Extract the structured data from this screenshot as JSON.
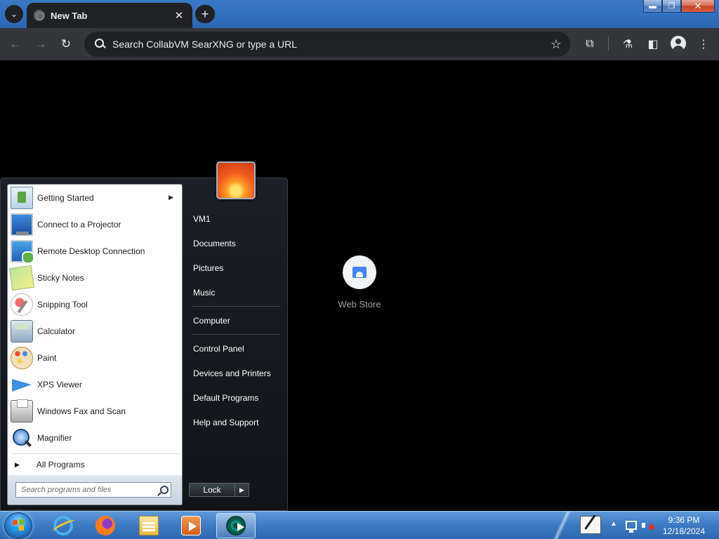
{
  "browser": {
    "tab": {
      "title": "New Tab",
      "close_glyph": "✕"
    },
    "new_tab_glyph": "+",
    "tab_list_glyph": "⌄",
    "window_controls": {
      "minimize": "▬",
      "restore": "❐",
      "close": "✕"
    },
    "nav": {
      "back": "←",
      "forward": "→",
      "reload": "↻"
    },
    "omnibox": {
      "placeholder": "Search CollabVM SearXNG or type a URL"
    },
    "bookmark_glyph": "☆",
    "toolbar_glyphs": {
      "extensions": "⧉",
      "labs": "⚗",
      "side_panel": "◧",
      "menu": "⋮"
    }
  },
  "new_tab_page": {
    "shortcuts": [
      {
        "label": "Web Store",
        "icon": "web-store-icon"
      }
    ]
  },
  "start_menu": {
    "programs": [
      {
        "label": "Getting Started",
        "icon": "getting-started-icon",
        "has_submenu": true
      },
      {
        "label": "Connect to a Projector",
        "icon": "projector-icon"
      },
      {
        "label": "Remote Desktop Connection",
        "icon": "remote-desktop-icon"
      },
      {
        "label": "Sticky Notes",
        "icon": "sticky-notes-icon"
      },
      {
        "label": "Snipping Tool",
        "icon": "snipping-tool-icon"
      },
      {
        "label": "Calculator",
        "icon": "calculator-icon"
      },
      {
        "label": "Paint",
        "icon": "paint-icon"
      },
      {
        "label": "XPS Viewer",
        "icon": "xps-viewer-icon"
      },
      {
        "label": "Windows Fax and Scan",
        "icon": "fax-scan-icon"
      },
      {
        "label": "Magnifier",
        "icon": "magnifier-icon"
      }
    ],
    "submenu_arrow": "▶",
    "all_programs": {
      "label": "All Programs",
      "arrow": "▶"
    },
    "search": {
      "placeholder": "Search programs and files"
    },
    "right_items": {
      "group1": [
        "VM1",
        "Documents",
        "Pictures",
        "Music"
      ],
      "group2": [
        "Computer"
      ],
      "group3": [
        "Control Panel",
        "Devices and Printers",
        "Default Programs",
        "Help and Support"
      ]
    },
    "lock": {
      "label": "Lock",
      "arrow": "▶"
    }
  },
  "taskbar": {
    "apps": [
      "internet-explorer",
      "firefox",
      "windows-explorer",
      "media-player",
      "chrome"
    ],
    "tray_arrow": "▲",
    "clock": {
      "time": "9:36 PM",
      "date": "12/18/2024"
    }
  },
  "colors": {
    "titlebar": "#2f6fbd",
    "chrome_dark": "#202124",
    "toolbar": "#35363a",
    "start_menu_bg": "#1b2026",
    "taskbar": "#3f7cc4"
  }
}
